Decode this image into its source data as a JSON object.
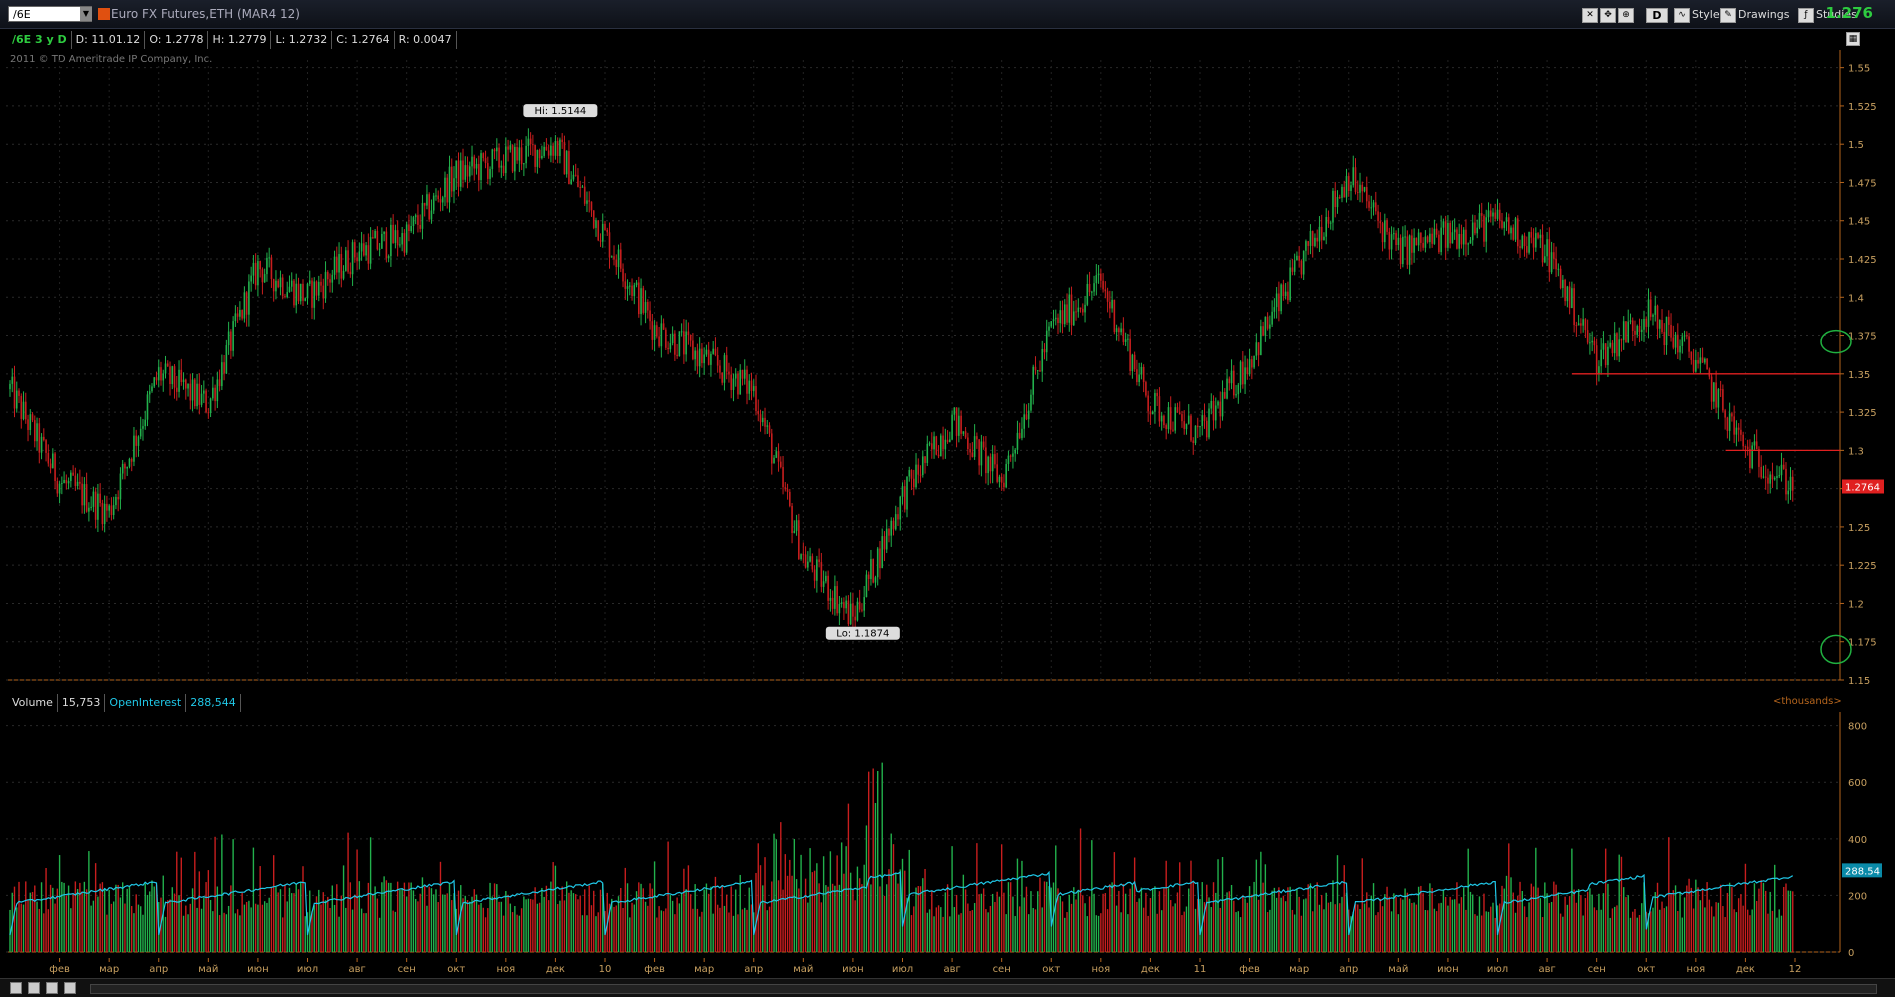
{
  "toolbar": {
    "symbol": "/6E",
    "description": "Euro FX Futures,ETH (MAR4 12)",
    "style_label": "Style",
    "drawings_label": "Drawings",
    "studies_label": "Studies",
    "period_button": "D",
    "last_price": "1.276"
  },
  "info": {
    "symbol_period": "/6E 3 y D",
    "date": "D: 11.01.12",
    "open": "O: 1.2778",
    "high": "H: 1.2779",
    "low": "L: 1.2732",
    "close": "C: 1.2764",
    "range": "R: 0.0047"
  },
  "copyright": "2011 © TD Ameritrade IP Company, Inc.",
  "price_panel": {
    "hi_label": "Hi: 1.5144",
    "lo_label": "Lo: 1.1874",
    "current_price_label": "1.2764",
    "y_ticks": [
      "1.55",
      "1.525",
      "1.5",
      "1.475",
      "1.45",
      "1.425",
      "1.4",
      "1.375",
      "1.35",
      "1.325",
      "1.3",
      "1.275",
      "1.25",
      "1.225",
      "1.2",
      "1.175",
      "1.15"
    ]
  },
  "volume_panel": {
    "volume_label": "Volume",
    "volume_value": "15,753",
    "oi_label": "OpenInterest",
    "oi_value": "288,544",
    "units": "<thousands>",
    "oi_current_label": "288.54",
    "y_ticks": [
      "800",
      "600",
      "400",
      "200",
      "0"
    ]
  },
  "x_axis": [
    "фев",
    "мар",
    "апр",
    "май",
    "июн",
    "июл",
    "авг",
    "сен",
    "окт",
    "ноя",
    "дек",
    "10",
    "фев",
    "мар",
    "апр",
    "май",
    "июн",
    "июл",
    "авг",
    "сен",
    "окт",
    "ноя",
    "дек",
    "11",
    "фев",
    "мар",
    "апр",
    "май",
    "июн",
    "июл",
    "авг",
    "сен",
    "окт",
    "ноя",
    "дек",
    "12"
  ],
  "colors": {
    "up": "#22b14c",
    "down": "#c81e1e",
    "oi": "#20c8e8",
    "axis": "#b5651d",
    "hline": "#e02020",
    "circle": "#20b040"
  },
  "chart_data": [
    {
      "type": "line",
      "title": "",
      "series_name": "/6E",
      "y_range": [
        1.15,
        1.555
      ],
      "x": [
        "2009-01",
        "2009-02",
        "2009-03",
        "2009-04",
        "2009-05",
        "2009-06",
        "2009-07",
        "2009-08",
        "2009-09",
        "2009-10",
        "2009-11",
        "2009-12",
        "2010-01",
        "2010-02",
        "2010-03",
        "2010-04",
        "2010-05",
        "2010-06",
        "2010-07",
        "2010-08",
        "2010-09",
        "2010-10",
        "2010-11",
        "2010-12",
        "2011-01",
        "2011-02",
        "2011-03",
        "2011-04",
        "2011-05",
        "2011-06",
        "2011-07",
        "2011-08",
        "2011-09",
        "2011-10",
        "2011-11",
        "2011-12",
        "2012-01"
      ],
      "y": [
        1.34,
        1.28,
        1.26,
        1.35,
        1.33,
        1.42,
        1.4,
        1.43,
        1.44,
        1.48,
        1.49,
        1.5,
        1.44,
        1.38,
        1.36,
        1.34,
        1.23,
        1.19,
        1.27,
        1.32,
        1.28,
        1.38,
        1.41,
        1.33,
        1.31,
        1.36,
        1.42,
        1.48,
        1.43,
        1.44,
        1.45,
        1.43,
        1.36,
        1.39,
        1.36,
        1.3,
        1.276
      ],
      "hi": 1.5144,
      "lo": 1.1874,
      "last": 1.2764
    },
    {
      "type": "bar",
      "title": "Volume",
      "unit": "thousands",
      "y_range": [
        0,
        820
      ],
      "x_range": [
        "2009-01",
        "2012-01"
      ],
      "oi_last": 288.54
    }
  ]
}
